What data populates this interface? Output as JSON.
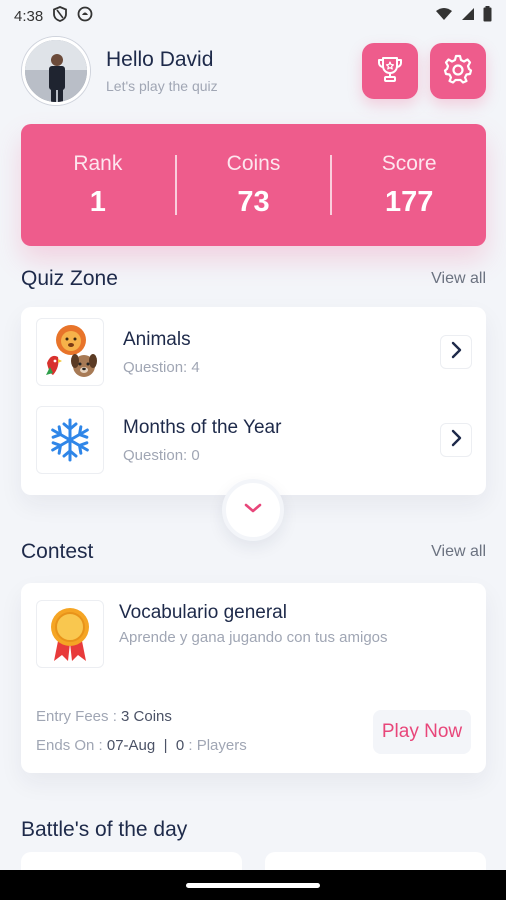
{
  "status_bar": {
    "time": "4:38"
  },
  "header": {
    "greeting": "Hello David",
    "subtitle": "Let's play the quiz"
  },
  "stats": [
    {
      "label": "Rank",
      "value": "1"
    },
    {
      "label": "Coins",
      "value": "73"
    },
    {
      "label": "Score",
      "value": "177"
    }
  ],
  "quiz_zone": {
    "title": "Quiz Zone",
    "view_all": "View all",
    "items": [
      {
        "name": "Animals",
        "questions": "Question: 4",
        "icon": "animals-icon"
      },
      {
        "name": "Months of the Year",
        "questions": "Question: 0",
        "icon": "snowflake-icon"
      }
    ]
  },
  "contest": {
    "title": "Contest",
    "view_all": "View all",
    "item": {
      "name": "Vocabulario general",
      "description": "Aprende y gana jugando con tus amigos",
      "entry_label": "Entry Fees :",
      "entry_value": "3 Coins",
      "ends_label": "Ends On :",
      "ends_value": "07-Aug",
      "separator": "|",
      "players_count": "0",
      "players_label": ": Players",
      "play_button": "Play Now"
    }
  },
  "battles": {
    "title": "Battle's of the day"
  },
  "colors": {
    "accent": "#ee5c8c",
    "background": "#f3f5f9",
    "text": "#1e2a4a",
    "muted": "#a0a6b4"
  }
}
